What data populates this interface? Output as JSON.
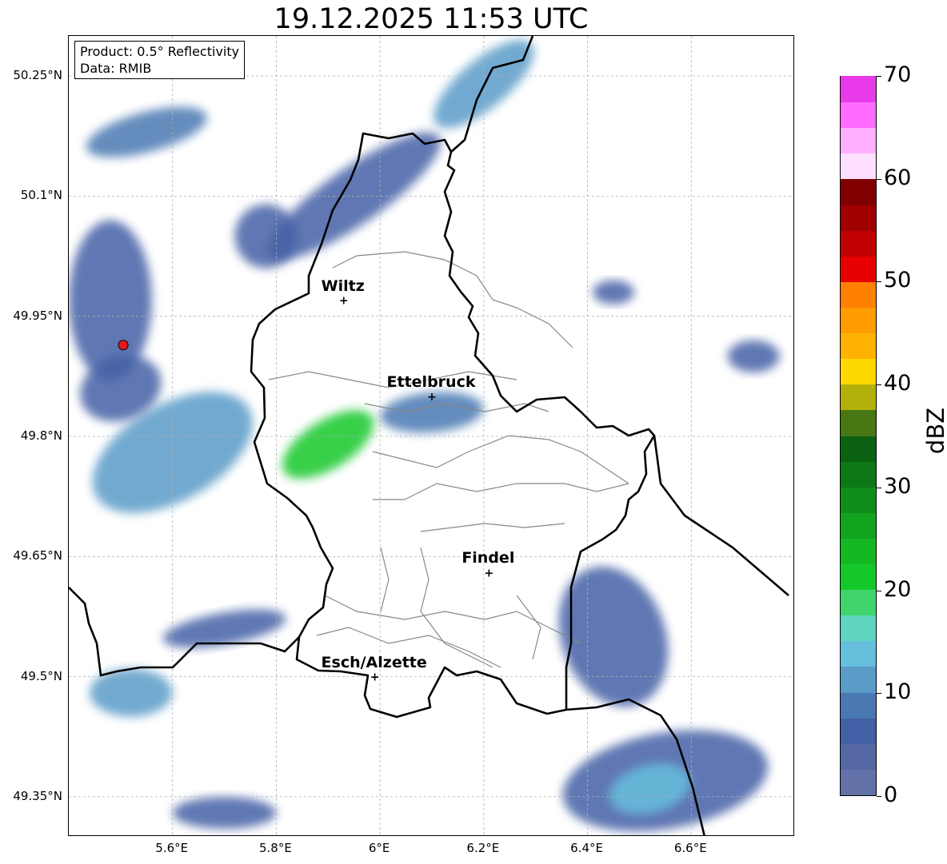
{
  "title": "19.12.2025 11:53 UTC",
  "info": {
    "product": "Product: 0.5° Reflectivity",
    "source": "Data: RMIB"
  },
  "axes": {
    "lon_range": [
      5.4,
      6.8
    ],
    "lat_range": [
      49.3,
      50.3
    ],
    "lat_ticks": [
      {
        "value": 50.25,
        "label": "50.25°N"
      },
      {
        "value": 50.1,
        "label": "50.1°N"
      },
      {
        "value": 49.95,
        "label": "49.95°N"
      },
      {
        "value": 49.8,
        "label": "49.8°N"
      },
      {
        "value": 49.65,
        "label": "49.65°N"
      },
      {
        "value": 49.5,
        "label": "49.5°N"
      },
      {
        "value": 49.35,
        "label": "49.35°N"
      }
    ],
    "lon_ticks": [
      {
        "value": 5.6,
        "label": "5.6°E"
      },
      {
        "value": 5.8,
        "label": "5.8°E"
      },
      {
        "value": 6.0,
        "label": "6°E"
      },
      {
        "value": 6.2,
        "label": "6.2°E"
      },
      {
        "value": 6.4,
        "label": "6.4°E"
      },
      {
        "value": 6.6,
        "label": "6.6°E"
      }
    ],
    "grid": true
  },
  "cities": [
    {
      "name": "Wiltz",
      "lon": 5.93,
      "lat": 49.97
    },
    {
      "name": "Ettelbruck",
      "lon": 6.1,
      "lat": 49.85
    },
    {
      "name": "Findel",
      "lon": 6.21,
      "lat": 49.63
    },
    {
      "name": "Esch/Alzette",
      "lon": 5.99,
      "lat": 49.5
    }
  ],
  "radar_site": {
    "lon": 5.505,
    "lat": 49.914,
    "color": "#e41a1c"
  },
  "colorbar": {
    "unit": "dBZ",
    "min": 0,
    "max": 70,
    "step": 2.5,
    "ticks": [
      {
        "value": 0,
        "label": "0"
      },
      {
        "value": 10,
        "label": "10"
      },
      {
        "value": 20,
        "label": "20"
      },
      {
        "value": 30,
        "label": "30"
      },
      {
        "value": 40,
        "label": "40"
      },
      {
        "value": 50,
        "label": "50"
      },
      {
        "value": 60,
        "label": "60"
      },
      {
        "value": 70,
        "label": "70"
      }
    ],
    "colors": [
      "#6272a8",
      "#5566a4",
      "#4460a6",
      "#4a78b2",
      "#5a9bc8",
      "#66bfdd",
      "#5fd5c0",
      "#3fd46c",
      "#14c82a",
      "#14b823",
      "#12a31e",
      "#0f8d1b",
      "#0d7816",
      "#0a6212",
      "#487714",
      "#b2b10a",
      "#ffd800",
      "#ffb300",
      "#ff9c00",
      "#ff7f00",
      "#e60000",
      "#c00000",
      "#a00000",
      "#800000",
      "#ffdfff",
      "#ffb0ff",
      "#ff6cff",
      "#e83ae8"
    ]
  },
  "echo_regions": [
    {
      "lon": 5.6,
      "lat": 49.78,
      "rlon": 0.17,
      "rlat": 0.06,
      "angle": -30,
      "dbz": 12
    },
    {
      "lon": 5.9,
      "lat": 49.79,
      "rlon": 0.1,
      "rlat": 0.03,
      "angle": -32,
      "dbz": 22
    },
    {
      "lon": 6.1,
      "lat": 49.83,
      "rlon": 0.1,
      "rlat": 0.025,
      "angle": -5,
      "dbz": 8
    },
    {
      "lon": 5.95,
      "lat": 50.1,
      "rlon": 0.2,
      "rlat": 0.035,
      "angle": -35,
      "dbz": 6
    },
    {
      "lon": 6.2,
      "lat": 50.24,
      "rlon": 0.12,
      "rlat": 0.03,
      "angle": -40,
      "dbz": 12
    },
    {
      "lon": 5.55,
      "lat": 50.18,
      "rlon": 0.12,
      "rlat": 0.025,
      "angle": -15,
      "dbz": 8
    },
    {
      "lon": 5.78,
      "lat": 50.05,
      "rlon": 0.06,
      "rlat": 0.04,
      "angle": 0,
      "dbz": 5
    },
    {
      "lon": 5.48,
      "lat": 49.97,
      "rlon": 0.08,
      "rlat": 0.1,
      "angle": 0,
      "dbz": 6
    },
    {
      "lon": 5.52,
      "lat": 49.48,
      "rlon": 0.08,
      "rlat": 0.03,
      "angle": 0,
      "dbz": 10
    },
    {
      "lon": 5.7,
      "lat": 49.56,
      "rlon": 0.12,
      "rlat": 0.02,
      "angle": -10,
      "dbz": 5
    },
    {
      "lon": 6.45,
      "lat": 49.55,
      "rlon": 0.1,
      "rlat": 0.09,
      "angle": -20,
      "dbz": 5
    },
    {
      "lon": 6.55,
      "lat": 49.37,
      "rlon": 0.2,
      "rlat": 0.06,
      "angle": -10,
      "dbz": 7
    },
    {
      "lon": 6.52,
      "lat": 49.36,
      "rlon": 0.08,
      "rlat": 0.03,
      "angle": -15,
      "dbz": 14
    },
    {
      "lon": 6.72,
      "lat": 49.9,
      "rlon": 0.05,
      "rlat": 0.02,
      "angle": 0,
      "dbz": 5
    },
    {
      "lon": 5.7,
      "lat": 49.33,
      "rlon": 0.1,
      "rlat": 0.02,
      "angle": 0,
      "dbz": 5
    },
    {
      "lon": 6.45,
      "lat": 49.98,
      "rlon": 0.04,
      "rlat": 0.015,
      "angle": 0,
      "dbz": 5
    },
    {
      "lon": 5.5,
      "lat": 49.86,
      "rlon": 0.08,
      "rlat": 0.04,
      "angle": -20,
      "dbz": 6
    }
  ]
}
